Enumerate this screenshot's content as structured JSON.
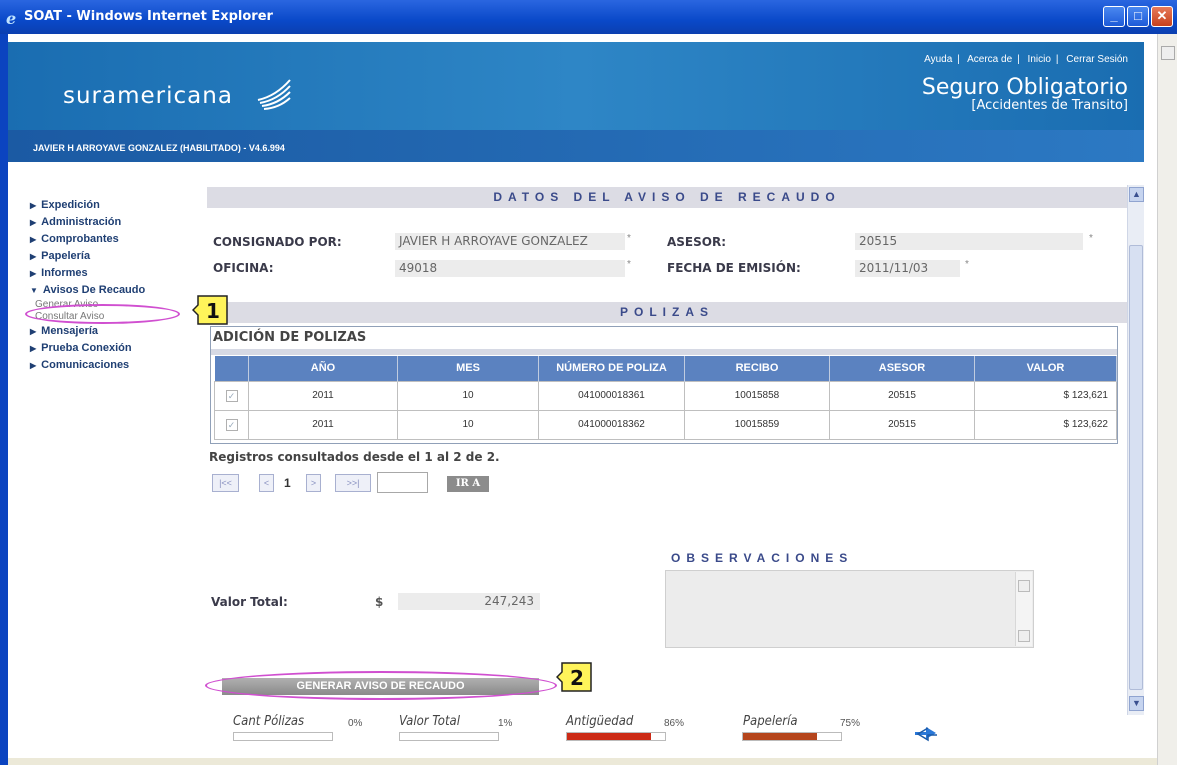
{
  "window": {
    "title": "SOAT - Windows Internet Explorer",
    "minimize": "_",
    "maximize": "□",
    "close": "✕"
  },
  "header": {
    "logo": "suramericana",
    "links": [
      "Ayuda",
      "Acerca de",
      "Inicio",
      "Cerrar Sesión"
    ],
    "product": "Seguro Obligatorio",
    "product_sub": "[Accidentes de Transito]",
    "user": "JAVIER H ARROYAVE GONZALEZ (HABILITADO) - V4.6.994"
  },
  "sidebar": {
    "items": [
      {
        "label": "Expedición"
      },
      {
        "label": "Administración"
      },
      {
        "label": "Comprobantes"
      },
      {
        "label": "Papelería"
      },
      {
        "label": "Informes"
      },
      {
        "label": "Avisos De Recaudo"
      }
    ],
    "sub_items": [
      "Generar Aviso",
      "Consultar Aviso"
    ],
    "items_after": [
      {
        "label": "Mensajería"
      },
      {
        "label": "Prueba Conexión"
      },
      {
        "label": "Comunicaciones"
      }
    ]
  },
  "datos": {
    "section_title": "DATOS DEL AVISO DE RECAUDO",
    "consignado_label": "CONSIGNADO POR:",
    "consignado_value": "JAVIER H ARROYAVE GONZALEZ",
    "asesor_label": "ASESOR:",
    "asesor_value": "20515",
    "oficina_label": "OFICINA:",
    "oficina_value": "49018",
    "fecha_label": "FECHA DE EMISIÓN:",
    "fecha_value": "2011/11/03",
    "required_mark": "*"
  },
  "polizas": {
    "section_title": "POLIZAS",
    "table_title": "ADICIÓN DE POLIZAS",
    "columns": [
      "AÑO",
      "MES",
      "NÚMERO DE POLIZA",
      "RECIBO",
      "ASESOR",
      "VALOR"
    ],
    "rows": [
      {
        "anio": "2011",
        "mes": "10",
        "numero": "041000018361",
        "recibo": "10015858",
        "asesor": "20515",
        "valor": "$ 123,621"
      },
      {
        "anio": "2011",
        "mes": "10",
        "numero": "041000018362",
        "recibo": "10015859",
        "asesor": "20515",
        "valor": "$ 123,622"
      }
    ],
    "registros": "Registros consultados desde el 1 al 2 de 2.",
    "pager": {
      "first": "|<<",
      "prev": "<",
      "page": "1",
      "next": ">",
      "last": ">>|",
      "go": "IR A"
    }
  },
  "totales": {
    "valor_total_label": "Valor Total:",
    "currency": "$",
    "valor_total": "247,243",
    "observaciones_title": "OBSERVACIONES"
  },
  "actions": {
    "generar": "GENERAR AVISO DE RECAUDO"
  },
  "callouts": [
    "1",
    "2"
  ],
  "metrics": [
    {
      "label": "Cant Pólizas",
      "pct": "0%",
      "value": 0,
      "color": "#ffffff"
    },
    {
      "label": "Valor Total",
      "pct": "1%",
      "value": 1,
      "color": "#ffffff"
    },
    {
      "label": "Antigüedad",
      "pct": "86%",
      "value": 86,
      "color": "#cc2a16"
    },
    {
      "label": "Papelería",
      "pct": "75%",
      "value": 75,
      "color": "#b5451c"
    }
  ],
  "colors": {
    "header_blue": "#1a6db1",
    "table_header": "#5b82c0",
    "annotation_pink": "#d04fd0",
    "callout_yellow": "#fff45a"
  }
}
